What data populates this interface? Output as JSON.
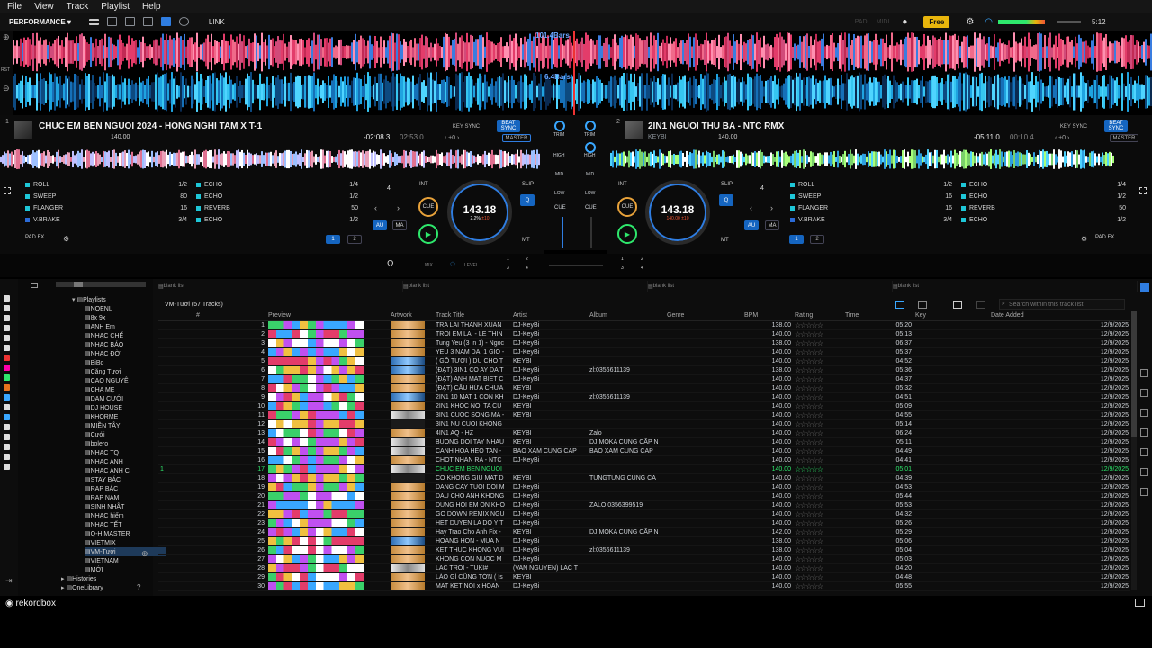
{
  "menu": [
    "File",
    "View",
    "Track",
    "Playlist",
    "Help"
  ],
  "toolbar": {
    "mode": "PERFORMANCE",
    "link": "LINK",
    "pad": "PAD",
    "midi": "MIDI",
    "plan": "Free",
    "clock": "5:12"
  },
  "waveform": {
    "deck1_bars": "101.4Bars",
    "deck2_bars": "6.4Bars",
    "rst": "RST"
  },
  "deck1": {
    "num": "1",
    "title": "CHUC EM BEN NGUOI 2024 - HONG NGHI TAM X T-1",
    "artist": "",
    "bpm_small": "140.00",
    "remain": "-02:08.3",
    "elapsed": "02:53.0",
    "key_sync": "KEY SYNC",
    "beat_sync": "BEAT SYNC",
    "master": "MASTER",
    "jog_bpm": "143.18",
    "jog_pct": "2.2%",
    "jog_rng": "±10",
    "quant": "4",
    "fx": [
      {
        "n": "ROLL",
        "v": "1/2",
        "c": "#1ec7d8"
      },
      {
        "n": "SWEEP",
        "v": "80",
        "c": "#1ec7d8"
      },
      {
        "n": "FLANGER",
        "v": "16",
        "c": "#1ec7d8"
      },
      {
        "n": "V.BRAKE",
        "v": "3/4",
        "c": "#2b6bd8"
      }
    ],
    "fx2": [
      {
        "n": "ECHO",
        "v": "1/4"
      },
      {
        "n": "ECHO",
        "v": "1/2"
      },
      {
        "n": "REVERB",
        "v": "50"
      },
      {
        "n": "ECHO",
        "v": "1/2"
      }
    ],
    "padfx": "PAD FX",
    "int": "INT",
    "slip": "SLIP",
    "cue": "CUE",
    "au": "AU",
    "ma": "MA",
    "mt": "MT",
    "q": "Q",
    "p1": "1",
    "p2": "2"
  },
  "deck2": {
    "num": "2",
    "title": "2IN1 NGUOI THU BA - NTC RMX",
    "artist": "KEYBI",
    "bpm_small": "140.00",
    "remain": "-05:11.0",
    "elapsed": "00:10.4",
    "key_sync": "KEY SYNC",
    "beat_sync": "BEAT SYNC",
    "master": "MASTER",
    "jog_bpm": "143.18",
    "jog_pct": "140.00",
    "jog_rng": "±10",
    "quant": "4",
    "fx": [
      {
        "n": "ROLL",
        "v": "1/2",
        "c": "#1ec7d8"
      },
      {
        "n": "SWEEP",
        "v": "16",
        "c": "#1ec7d8"
      },
      {
        "n": "FLANGER",
        "v": "16",
        "c": "#1ec7d8"
      },
      {
        "n": "V.BRAKE",
        "v": "3/4",
        "c": "#2b6bd8"
      }
    ],
    "fx2": [
      {
        "n": "ECHO",
        "v": "1/4"
      },
      {
        "n": "ECHO",
        "v": "1/2"
      },
      {
        "n": "REVERB",
        "v": "50"
      },
      {
        "n": "ECHO",
        "v": "1/2"
      }
    ],
    "padfx": "PAD FX",
    "int": "INT",
    "slip": "SLIP",
    "cue": "CUE",
    "au": "AU",
    "ma": "MA",
    "mt": "MT",
    "q": "Q",
    "p1": "1",
    "p2": "2"
  },
  "mixer": {
    "trim": "TRIM",
    "high": "HIGH",
    "mid": "MID",
    "low": "LOW",
    "cue": "CUE",
    "mix": "MIX",
    "level": "LEVEL",
    "q1": "1",
    "q2": "2",
    "q3": "3",
    "q4": "4"
  },
  "browser": {
    "panes": [
      "blank list",
      "blank list",
      "blank list",
      "blank list"
    ],
    "playlist_title": "VM-Tươi (57 Tracks)",
    "search_placeholder": "Search within this track list",
    "columns": [
      "#",
      "Preview",
      "Artwork",
      "Track Title",
      "Artist",
      "Album",
      "Genre",
      "BPM",
      "Rating",
      "Time",
      "Key",
      "Date Added"
    ],
    "tree_top": [
      "Playlists"
    ],
    "tree": [
      "NOENL",
      "8x 9x",
      "ANH Em",
      "NHẠC CHẾ",
      "NHẠC BÁO",
      "NHẠC ĐỜI",
      "BiBo",
      "Căng Tươi",
      "CAO NGUYÊ",
      "CHA MẸ",
      "DAM CƯỚI",
      "DJ HOUSE",
      "KHORME",
      "MIỀN TÂY",
      "Cưới",
      "bolero",
      "NHẠC TQ",
      "NHẠC ANH",
      "NHẠC ANH C",
      "STAY BÁC",
      "RAP BÁC",
      "RAP NAM",
      "SINH NHẬT",
      "NHẠC hiếm",
      "NHẠC TẾT",
      "Q-H MASTER",
      "VIETMIX",
      "VM-Tươi",
      "VIETNAM",
      "MỚI"
    ],
    "tree_bottom": [
      "Histories",
      "OneLibrary"
    ],
    "rows": [
      {
        "n": "1",
        "t": "TRA LAI THANH XUAN",
        "a": "DJ-KeyBi",
        "al": "",
        "b": "138.00",
        "tm": "05:20",
        "d": "12/9/2025",
        "art": 1
      },
      {
        "n": "2",
        "t": "TROI EM LAI - LE THIN",
        "a": "DJ-KeyBi",
        "al": "",
        "b": "140.00",
        "tm": "05:13",
        "d": "12/9/2025",
        "art": 1
      },
      {
        "n": "3",
        "t": "Tung Yeu (3 In 1) - Ngoc",
        "a": "DJ-KeyBi",
        "al": "",
        "b": "138.00",
        "tm": "06:37",
        "d": "12/9/2025",
        "art": 1
      },
      {
        "n": "4",
        "t": "YEU 3 NAM DAI 1 GIO -",
        "a": "DJ-KeyBi",
        "al": "",
        "b": "140.00",
        "tm": "05:37",
        "d": "12/9/2025",
        "art": 1
      },
      {
        "n": "5",
        "t": "( GỖ TƯƠI ) DU CHO T",
        "a": "KEYBI",
        "al": "",
        "b": "140.00",
        "tm": "04:52",
        "d": "12/9/2025",
        "art": 2
      },
      {
        "n": "6",
        "t": "(ĐẠT) 3IN1 CO AY DA T",
        "a": "DJ-KeyBi",
        "al": "zl:0356611139",
        "b": "138.00",
        "tm": "05:36",
        "d": "12/9/2025",
        "art": 2
      },
      {
        "n": "7",
        "t": "(ĐẠT) ANH MAT BIET C",
        "a": "DJ-KeyBi",
        "al": "",
        "b": "140.00",
        "tm": "04:37",
        "d": "12/9/2025",
        "art": 1
      },
      {
        "n": "8",
        "t": "(ĐẠT) CẦU HỨA CHƯA",
        "a": "KEYBI",
        "al": "",
        "b": "140.00",
        "tm": "05:32",
        "d": "12/9/2025",
        "art": 1
      },
      {
        "n": "9",
        "t": "2IN1 10 MAT 1 CON KH",
        "a": "DJ-KeyBi",
        "al": "zl:0356611139",
        "b": "140.00",
        "tm": "04:51",
        "d": "12/9/2025",
        "art": 2
      },
      {
        "n": "10",
        "t": "2IN1 KHOC NOI TA CU",
        "a": "KEYBI",
        "al": "",
        "b": "140.00",
        "tm": "05:09",
        "d": "12/9/2025",
        "art": 1
      },
      {
        "n": "11",
        "t": "3IN1 CUOC SONG MA -",
        "a": "KEYBI",
        "al": "",
        "b": "140.00",
        "tm": "04:55",
        "d": "12/9/2025",
        "art": 3
      },
      {
        "n": "12",
        "t": "3IN1 NU CUOI KHONG",
        "a": "",
        "al": "",
        "b": "140.00",
        "tm": "05:14",
        "d": "12/9/2025",
        "art": 0
      },
      {
        "n": "13",
        "t": "4IN1 AQ - HZ",
        "a": "KEYBI",
        "al": "Zalo",
        "b": "140.00",
        "tm": "06:24",
        "d": "12/9/2025",
        "art": 1
      },
      {
        "n": "14",
        "t": "BUONG DOI TAY NHAU",
        "a": "KEYBI",
        "al": "DJ MOKA CUNG CẤP N",
        "b": "140.00",
        "tm": "05:11",
        "d": "12/9/2025",
        "art": 3
      },
      {
        "n": "15",
        "t": "CANH HOA HEO TAN -",
        "a": "BAO XAM CUNG CAP",
        "al": "BAO XAM CUNG CAP",
        "b": "140.00",
        "tm": "04:49",
        "d": "12/9/2025",
        "art": 3
      },
      {
        "n": "16",
        "t": "CHOT NHAN RA - NTC",
        "a": "DJ-KeyBi",
        "al": "",
        "b": "140.00",
        "tm": "04:41",
        "d": "12/9/2025",
        "art": 1
      },
      {
        "n": "17",
        "t": "CHUC EM BEN NGUOI",
        "a": "",
        "al": "",
        "b": "140.00",
        "tm": "05:01",
        "d": "12/9/2025",
        "art": 3,
        "playing": true
      },
      {
        "n": "18",
        "t": "CO KHONG GIU MAT D",
        "a": "KEYBI",
        "al": "TUNGTUNG CUNG CA",
        "b": "140.00",
        "tm": "04:39",
        "d": "12/9/2025",
        "art": 0
      },
      {
        "n": "19",
        "t": "DANG CAY TUOI DOI M",
        "a": "DJ-KeyBi",
        "al": "",
        "b": "140.00",
        "tm": "04:53",
        "d": "12/9/2025",
        "art": 1
      },
      {
        "n": "20",
        "t": "DAU CHO ANH KHONG",
        "a": "DJ-KeyBi",
        "al": "",
        "b": "140.00",
        "tm": "05:44",
        "d": "12/9/2025",
        "art": 1
      },
      {
        "n": "21",
        "t": "DUNG HOI EM ON KHO",
        "a": "DJ-KeyBi",
        "al": "ZALO 0356399519",
        "b": "140.00",
        "tm": "05:53",
        "d": "12/9/2025",
        "art": 1
      },
      {
        "n": "22",
        "t": "GO DOWN REMIX NGU",
        "a": "DJ-KeyBi",
        "al": "",
        "b": "140.00",
        "tm": "04:32",
        "d": "12/9/2025",
        "art": 1
      },
      {
        "n": "23",
        "t": "HET DUYEN LA DO Y T",
        "a": "DJ-KeyBi",
        "al": "",
        "b": "140.00",
        "tm": "05:26",
        "d": "12/9/2025",
        "art": 1
      },
      {
        "n": "24",
        "t": "Hay Trao Cho Anh Fix -",
        "a": "KEYBI",
        "al": "DJ MOKA CUNG CẤP N",
        "b": "142.00",
        "tm": "05:29",
        "d": "12/9/2025",
        "art": 1
      },
      {
        "n": "25",
        "t": "HOANG HON - MUA N",
        "a": "DJ-KeyBi",
        "al": "",
        "b": "138.00",
        "tm": "05:06",
        "d": "12/9/2025",
        "art": 2
      },
      {
        "n": "26",
        "t": "KET THUC KHONG VUI",
        "a": "DJ-KeyBi",
        "al": "zl:0356611139",
        "b": "138.00",
        "tm": "05:04",
        "d": "12/9/2025",
        "art": 1
      },
      {
        "n": "27",
        "t": "KHONG CON NUOC M",
        "a": "DJ-KeyBi",
        "al": "",
        "b": "140.00",
        "tm": "05:03",
        "d": "12/9/2025",
        "art": 1
      },
      {
        "n": "28",
        "t": "LAC TROI - TUKI#",
        "a": "(VAN NGUYEN) LAC T",
        "al": "",
        "b": "140.00",
        "tm": "04:20",
        "d": "12/9/2025",
        "art": 3
      },
      {
        "n": "29",
        "t": "LÁO GÌ CŨNG TỚN ( Is",
        "a": "KEYBI",
        "al": "",
        "b": "140.00",
        "tm": "04:48",
        "d": "12/9/2025",
        "art": 1
      },
      {
        "n": "30",
        "t": "MAT KET NOI x HOAN",
        "a": "DJ-KeyBi",
        "al": "",
        "b": "140.00",
        "tm": "05:55",
        "d": "12/9/2025",
        "art": 1
      }
    ]
  },
  "footer": {
    "brand": "rekordbox"
  },
  "colors": {
    "accent": "#2f7de1",
    "playing": "#2ee86c",
    "free": "#e8b50c"
  }
}
